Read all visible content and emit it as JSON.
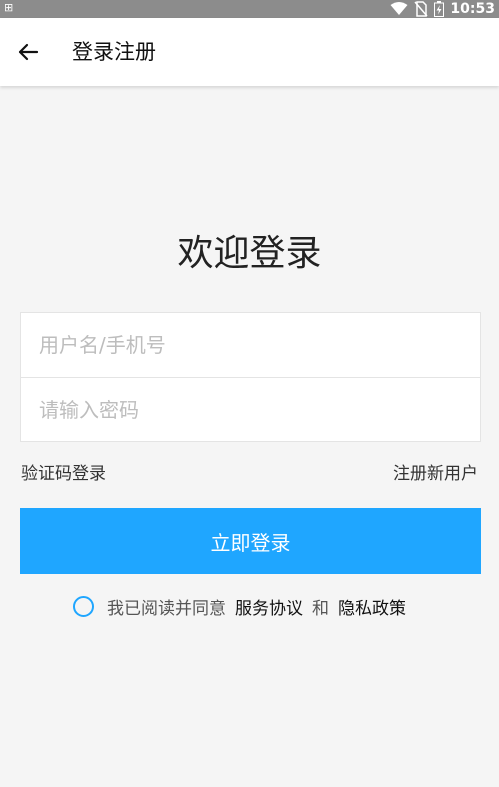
{
  "status_bar": {
    "left_glyph": "⊞",
    "time": "10:53",
    "icons": [
      "wifi-icon",
      "no-sim-icon",
      "battery-charging-icon"
    ]
  },
  "app_bar": {
    "back_icon": "arrow-left-icon",
    "title": "登录注册"
  },
  "main": {
    "welcome": "欢迎登录",
    "username_placeholder": "用户名/手机号",
    "password_placeholder": "请输入密码",
    "sms_login": "验证码登录",
    "register": "注册新用户",
    "login_button": "立即登录"
  },
  "agreement": {
    "checked": false,
    "prefix": "我已阅读并同意",
    "service_link": "服务协议",
    "and": "和",
    "privacy_link": "隐私政策"
  },
  "colors": {
    "accent": "#1fa6ff",
    "background": "#f5f5f5",
    "status_bar": "#8c8c8c"
  }
}
